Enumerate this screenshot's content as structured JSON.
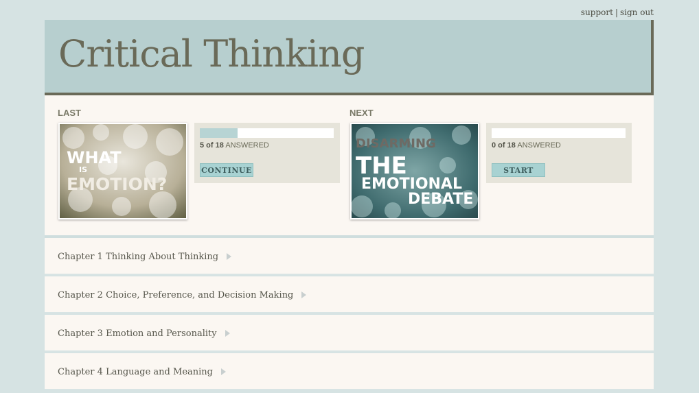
{
  "toplinks": {
    "support": "support",
    "separator": "|",
    "signout": "sign out"
  },
  "header": {
    "title": "Critical Thinking"
  },
  "last": {
    "label": "LAST",
    "thumb_lines": [
      "WHAT",
      "IS",
      "EMOTION?"
    ],
    "answered_count": "5 of 18",
    "answered_label": "ANSWERED",
    "progress": 0.28,
    "button_label": "CONTINUE"
  },
  "next": {
    "label": "NEXT",
    "thumb_lines": [
      "DISARMING",
      "THE",
      "EMOTIONAL",
      "DEBATE"
    ],
    "answered_count": "0 of 18",
    "answered_label": "ANSWERED",
    "progress": 0.0,
    "button_label": "START"
  },
  "chapters": [
    {
      "num": "Chapter 1",
      "title": "Thinking About Thinking"
    },
    {
      "num": "Chapter 2",
      "title": "Choice, Preference, and Decision Making"
    },
    {
      "num": "Chapter 3",
      "title": "Emotion and Personality"
    },
    {
      "num": "Chapter 4",
      "title": "Language and Meaning"
    }
  ],
  "colors": {
    "accent": "#a8d2d2",
    "header_bg": "#b7cfcf",
    "title": "#6a6a58"
  }
}
